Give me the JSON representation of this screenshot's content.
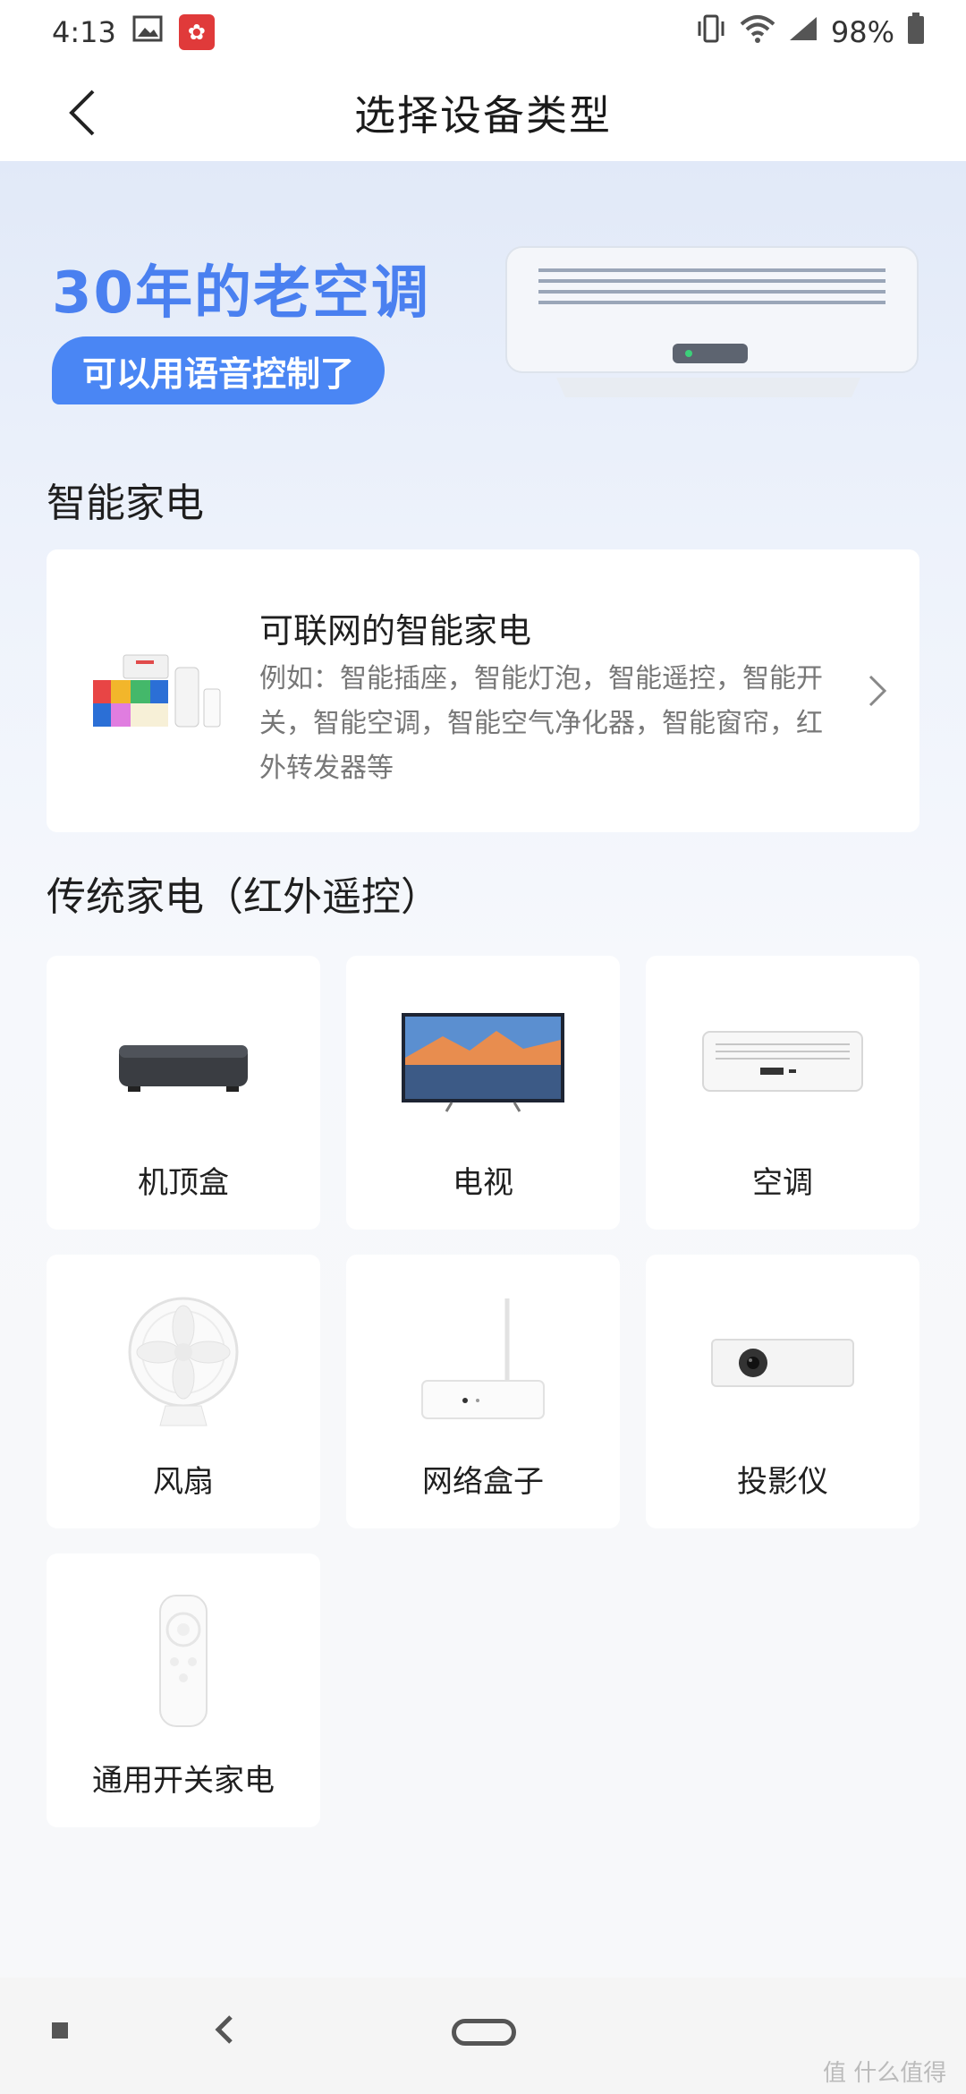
{
  "status_bar": {
    "time": "4:13",
    "battery": "98%"
  },
  "header": {
    "title": "选择设备类型"
  },
  "banner": {
    "headline": "30年的老空调",
    "tagline": "可以用语音控制了"
  },
  "smart_section": {
    "title": "智能家电",
    "card_title": "可联网的智能家电",
    "card_desc": "例如：智能插座，智能灯泡，智能遥控，智能开关，智能空调，智能空气净化器，智能窗帘，红外转发器等"
  },
  "ir_section": {
    "title": "传统家电（红外遥控）",
    "devices": [
      {
        "label": "机顶盒",
        "icon": "set-top-box"
      },
      {
        "label": "电视",
        "icon": "tv"
      },
      {
        "label": "空调",
        "icon": "air-conditioner"
      },
      {
        "label": "风扇",
        "icon": "fan"
      },
      {
        "label": "网络盒子",
        "icon": "network-box"
      },
      {
        "label": "投影仪",
        "icon": "projector"
      },
      {
        "label": "通用开关家电",
        "icon": "universal-remote"
      }
    ]
  },
  "watermark": "值 什么值得买",
  "colors": {
    "accent": "#4a86f4",
    "headline": "#4a80f0"
  }
}
